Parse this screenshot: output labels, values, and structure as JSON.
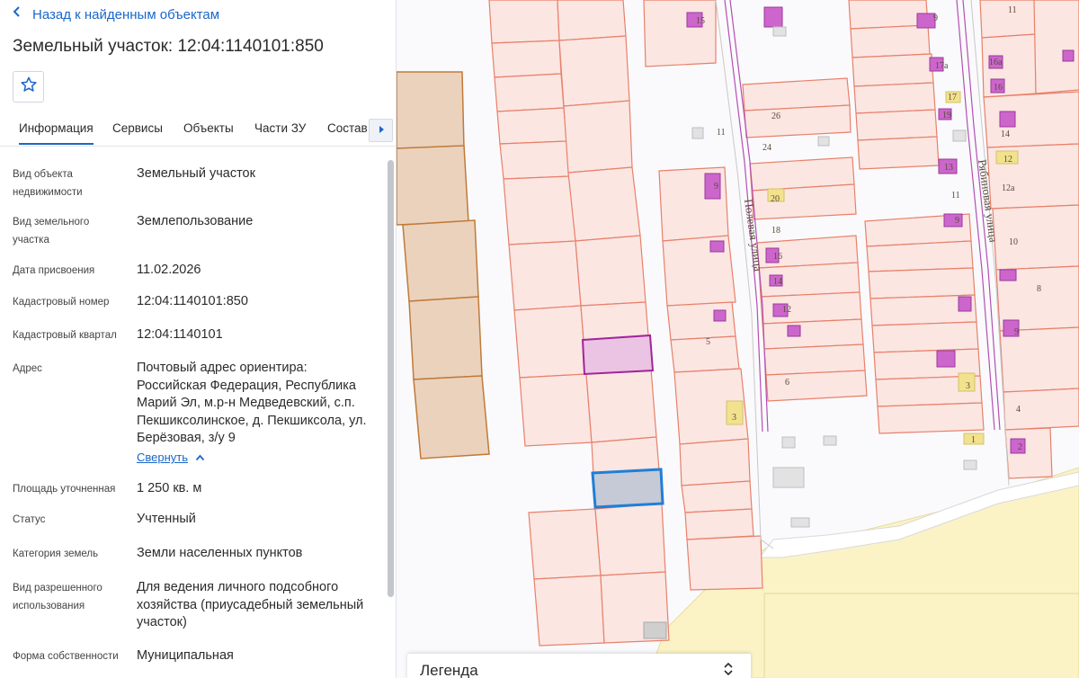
{
  "nav": {
    "back_label": "Назад к найденным объектам"
  },
  "title": "Земельный участок: 12:04:1140101:850",
  "tabs": [
    {
      "label": "Информация",
      "active": true
    },
    {
      "label": "Сервисы"
    },
    {
      "label": "Объекты"
    },
    {
      "label": "Части ЗУ"
    },
    {
      "label": "Состав"
    }
  ],
  "info": {
    "object_type": {
      "label": "Вид объекта недвижимости",
      "value": "Земельный участок"
    },
    "land_type": {
      "label": "Вид земельного участка",
      "value": "Землепользование"
    },
    "assigned_date": {
      "label": "Дата присвоения",
      "value": "11.02.2026"
    },
    "cadastral_number": {
      "label": "Кадастровый номер",
      "value": "12:04:1140101:850"
    },
    "cadastral_quarter": {
      "label": "Кадастровый квартал",
      "value": "12:04:1140101"
    },
    "address": {
      "label": "Адрес",
      "value": "Почтовый адрес ориентира: Российская Федерация, Республика Марий Эл, м.р-н Медведевский, с.п. Пекшиксолинское, д. Пекшиксола, ул. Берёзовая, з/у 9",
      "collapse_label": "Свернуть"
    },
    "area": {
      "label": "Площадь уточненная",
      "value": "1 250 кв. м"
    },
    "status": {
      "label": "Статус",
      "value": "Учтенный"
    },
    "category": {
      "label": "Категория земель",
      "value": "Земли населенных пунктов"
    },
    "permitted_use": {
      "label": "Вид разрешенного использования",
      "value": "Для ведения личного подсобного хозяйства (приусадебный земельный участок)"
    },
    "ownership": {
      "label": "Форма собственности",
      "value": "Муниципальная"
    }
  },
  "map": {
    "streets": [
      "Полевая улица",
      "Рябиновая улица"
    ],
    "house_numbers": [
      "15",
      "9",
      "11",
      "17а",
      "16а",
      "16",
      "17",
      "26",
      "19",
      "11",
      "24",
      "14",
      "13",
      "9",
      "20",
      "12",
      "12а",
      "11",
      "18",
      "9",
      "16",
      "10",
      "14",
      "12",
      "8",
      "9",
      "5",
      "3",
      "6",
      "3",
      "4",
      "1",
      "2"
    ],
    "colors": {
      "parcel_stroke": "#e8806a",
      "parcel_fill": "#fbe6e2",
      "selected_stroke": "#1f7fd6",
      "selected_fill": "#c5cad6",
      "highlight_stroke": "#a0259a",
      "building": "#cc66cc",
      "forest_fill": "#ebd2bd",
      "forest_stroke": "#c07a3a",
      "field_fill": "#fbf3c6"
    }
  },
  "legend": {
    "title": "Легенда"
  }
}
